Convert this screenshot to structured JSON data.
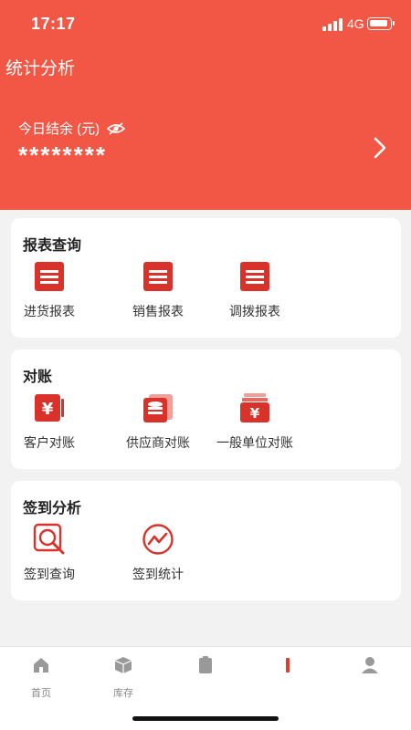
{
  "status": {
    "time": "17:17",
    "network": "4G"
  },
  "header": {
    "title": "统计分析",
    "balance_label": "今日结余 (元)",
    "balance_value": "********"
  },
  "sections": [
    {
      "title": "报表查询",
      "items": [
        {
          "label": "进货报表",
          "icon": "report-icon"
        },
        {
          "label": "销售报表",
          "icon": "report-icon"
        },
        {
          "label": "调拨报表",
          "icon": "report-icon"
        }
      ]
    },
    {
      "title": "对账",
      "items": [
        {
          "label": "客户对账",
          "icon": "yen-card-icon"
        },
        {
          "label": "供应商对账",
          "icon": "coin-stack-icon"
        },
        {
          "label": "一般单位对账",
          "icon": "yen-wallet-icon"
        }
      ]
    },
    {
      "title": "签到分析",
      "items": [
        {
          "label": "签到查询",
          "icon": "search-frame-icon"
        },
        {
          "label": "签到统计",
          "icon": "trend-circle-icon"
        }
      ]
    }
  ],
  "tabbar": [
    {
      "label": "首页",
      "icon": "home-icon"
    },
    {
      "label": "库存",
      "icon": "box-icon"
    },
    {
      "label": "",
      "icon": "document-icon"
    },
    {
      "label": "",
      "icon": "chart-icon"
    },
    {
      "label": "",
      "icon": "user-icon"
    }
  ],
  "colors": {
    "accent": "#f25745",
    "icon_red": "#d9322a"
  }
}
